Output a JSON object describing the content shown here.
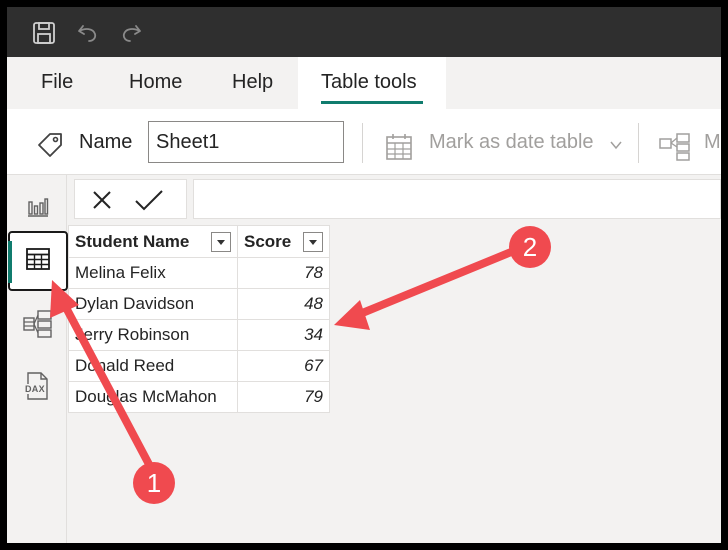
{
  "menu": {
    "items": [
      {
        "label": "File"
      },
      {
        "label": "Home"
      },
      {
        "label": "Help"
      },
      {
        "label": "Table tools"
      }
    ]
  },
  "ribbon": {
    "name_label": "Name",
    "name_value": "Sheet1",
    "mark_date_label": "Mark as date table",
    "manage_label_partial": "M"
  },
  "leftnav": {
    "items": [
      {
        "icon": "report-view-icon"
      },
      {
        "icon": "table-view-icon",
        "active": true
      },
      {
        "icon": "model-view-icon"
      },
      {
        "icon": "dax-query-view-icon",
        "text": "DAX"
      }
    ]
  },
  "table": {
    "columns": [
      "Student Name",
      "Score"
    ],
    "rows": [
      [
        "Melina Felix",
        "78"
      ],
      [
        "Dylan Davidson",
        "48"
      ],
      [
        "Jerry Robinson",
        "34"
      ],
      [
        "Donald Reed",
        "67"
      ],
      [
        "Douglas McMahon",
        "79"
      ]
    ]
  },
  "annotations": {
    "badge_1": "1",
    "badge_2": "2",
    "color": "#f04a4f"
  },
  "colors": {
    "accent": "#107c6e",
    "titlebar": "#2f2f2f",
    "annotation": "#f04a4f"
  }
}
